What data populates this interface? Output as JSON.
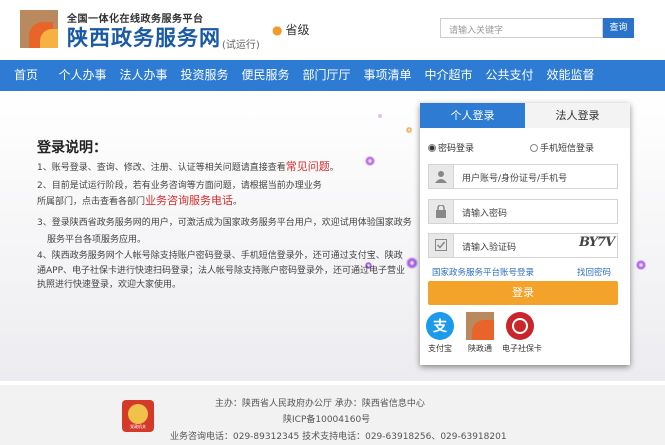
{
  "header": {
    "subtitle": "全国一体化在线政务服务平台",
    "title": "陕西政务服务网",
    "trial": "(试运行)",
    "location": "省级",
    "search_placeholder": "请输入关键字",
    "search_button": "查询"
  },
  "nav": [
    "首页",
    "个人办事",
    "法人办事",
    "投资服务",
    "便民服务",
    "部门厅厅",
    "事项清单",
    "中介超市",
    "公共支付",
    "效能监督"
  ],
  "intro": {
    "title": "登录说明：",
    "line1_a": "1、账号登录、查询、修改、注册、认证等相关问题请直接查看",
    "line1_b": "常见问题",
    "line1_c": "。",
    "line2": "2、目前是试运行阶段，若有业务咨询等方面问题，请根据当前办理业务",
    "line2b_a": "所属部门，点击查看各部门",
    "line2b_b": "业务咨询服务电话",
    "line2b_c": "。",
    "line3": "3、登录陕西省政务服务网的用户，可激活成为国家政务服务平台用户，欢迎试用体验国家政务",
    "line3b": "服务平台各项服务应用。",
    "line4": "4、陕西政务服务网个人帐号除支持账户密码登录、手机短信登录外，还可通过支付宝、陕政",
    "line4b": "通APP、电子社保卡进行快速扫码登录；法人帐号除支持账户密码登录外，还可通过电子营业",
    "line4c": "执照进行快速登录，欢迎大家使用。"
  },
  "login": {
    "tab_person": "个人登录",
    "tab_corp": "法人登录",
    "radio_password": "密码登录",
    "radio_sms": "手机短信登录",
    "username_placeholder": "用户账号/身份证号/手机号",
    "password_placeholder": "请输入密码",
    "captcha_placeholder": "请输入验证码",
    "captcha_text": "BY7V",
    "link_national": "国家政务服务平台账号登录",
    "link_forgot": "找回密码",
    "login_button": "登录",
    "alt_alipay": "支付宝",
    "alt_shanzhengtong": "陕政通",
    "alt_social_card": "电子社保卡"
  },
  "footer": {
    "line1": "主办：陕西省人民政府办公厅    承办：陕西省信息中心",
    "line2": "陕ICP备10004160号",
    "line3": "业务咨询电话：029-89312345  技术支持电话：029-63918256、029-63918201",
    "emblem_text": "党政机关"
  },
  "colors": {
    "brand_blue": "#2d7bd2",
    "title_blue": "#1a5aa5",
    "accent_orange": "#f4a32a",
    "highlight_red": "#d62d2d"
  }
}
